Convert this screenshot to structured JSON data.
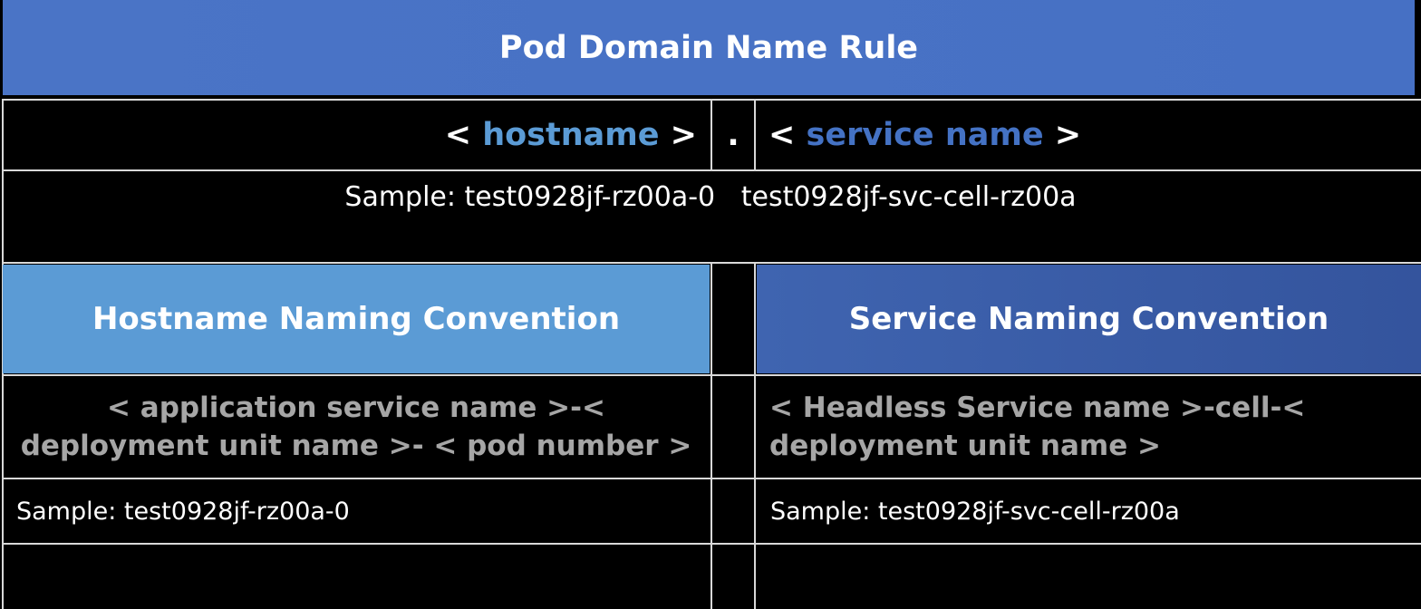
{
  "title": "Pod Domain Name Rule",
  "rule": {
    "open_bracket": "<",
    "hostname": "hostname",
    "close_bracket": ">",
    "separator": ".",
    "service_name": "service name"
  },
  "sample_main": "Sample: test0928jf-rz00a-0   test0928jf-svc-cell-rz00a",
  "hostname_convention": {
    "header": "Hostname Naming Convention",
    "pattern": "< application service name >-< deployment unit name >- < pod number >",
    "sample": "Sample: test0928jf-rz00a-0"
  },
  "service_convention": {
    "header": "Service Naming Convention",
    "pattern": "< Headless Service name >-cell-< deployment unit name >",
    "sample": "Sample: test0928jf-svc-cell-rz00a"
  },
  "colors": {
    "title_bg": "#4a74c6",
    "hostname_accent": "#5b9bd5",
    "service_accent": "#4472c4",
    "pattern_text": "#a6a6a6",
    "grid_line": "#d9d9d9",
    "background": "#000000"
  }
}
